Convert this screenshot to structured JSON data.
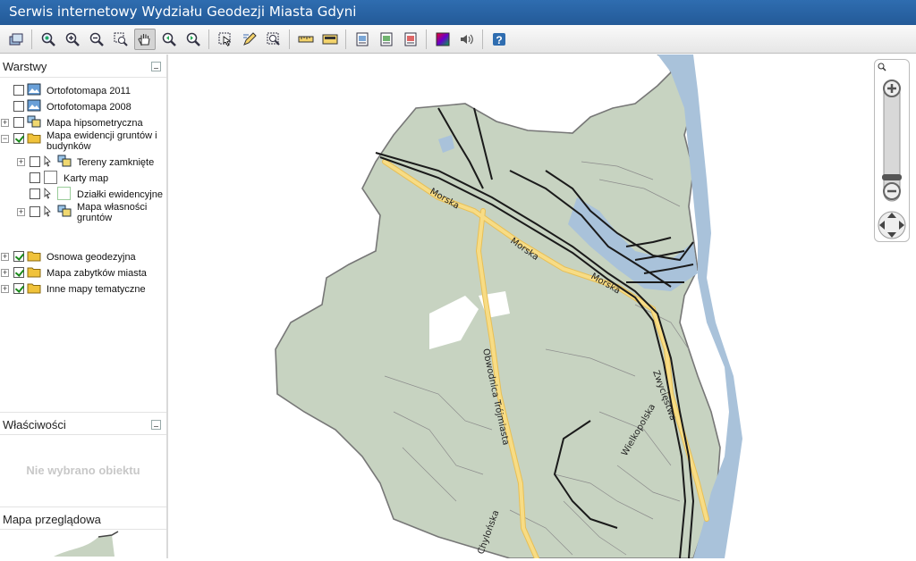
{
  "app": {
    "title": "Serwis internetowy Wydziału Geodezji Miasta Gdyni"
  },
  "toolbar": {
    "tools": [
      "layers-icon",
      "zoom-extent-icon",
      "zoom-in-icon",
      "zoom-out-icon",
      "zoom-box-icon",
      "pan-hand-icon",
      "zoom-prev-icon",
      "zoom-next-icon",
      "select-icon",
      "edit-icon",
      "identify-icon",
      "measure-distance-icon",
      "measure-area-icon",
      "print-icon",
      "export-icon",
      "report-icon",
      "color-palette-icon",
      "sound-icon",
      "help-icon"
    ]
  },
  "layers": {
    "title": "Warstwy",
    "items": [
      {
        "label": "Ortofotomapa 2011",
        "checked": false
      },
      {
        "label": "Ortofotomapa 2008",
        "checked": false
      },
      {
        "label": "Mapa hipsometryczna",
        "checked": false
      },
      {
        "label": "Mapa ewidencji gruntów i",
        "label2": "budynków",
        "checked": true
      },
      {
        "label": "Tereny zamknięte",
        "checked": false
      },
      {
        "label": "Karty map",
        "checked": false
      },
      {
        "label": "Działki ewidencyjne",
        "checked": false
      },
      {
        "label": "Mapa własności",
        "label2": "gruntów",
        "checked": false
      },
      {
        "label": "Osnowa geodezyjna",
        "checked": true
      },
      {
        "label": "Mapa zabytków miasta",
        "checked": true
      },
      {
        "label": "Inne mapy tematyczne",
        "checked": true
      }
    ]
  },
  "properties": {
    "title": "Właściwości",
    "empty": "Nie wybrano obiektu"
  },
  "overview": {
    "title": "Mapa przeglądowa"
  },
  "map": {
    "streets": [
      "Morska",
      "Morska",
      "Morska",
      "Obwodnica Trójmiasta",
      "Wielkopolska",
      "Zwycięstwa",
      "Chylońska"
    ],
    "colors": {
      "land": "#c7d3c1",
      "water": "#a9c2da",
      "road": "#f2cf6b",
      "rail": "#1a1a1a"
    }
  }
}
